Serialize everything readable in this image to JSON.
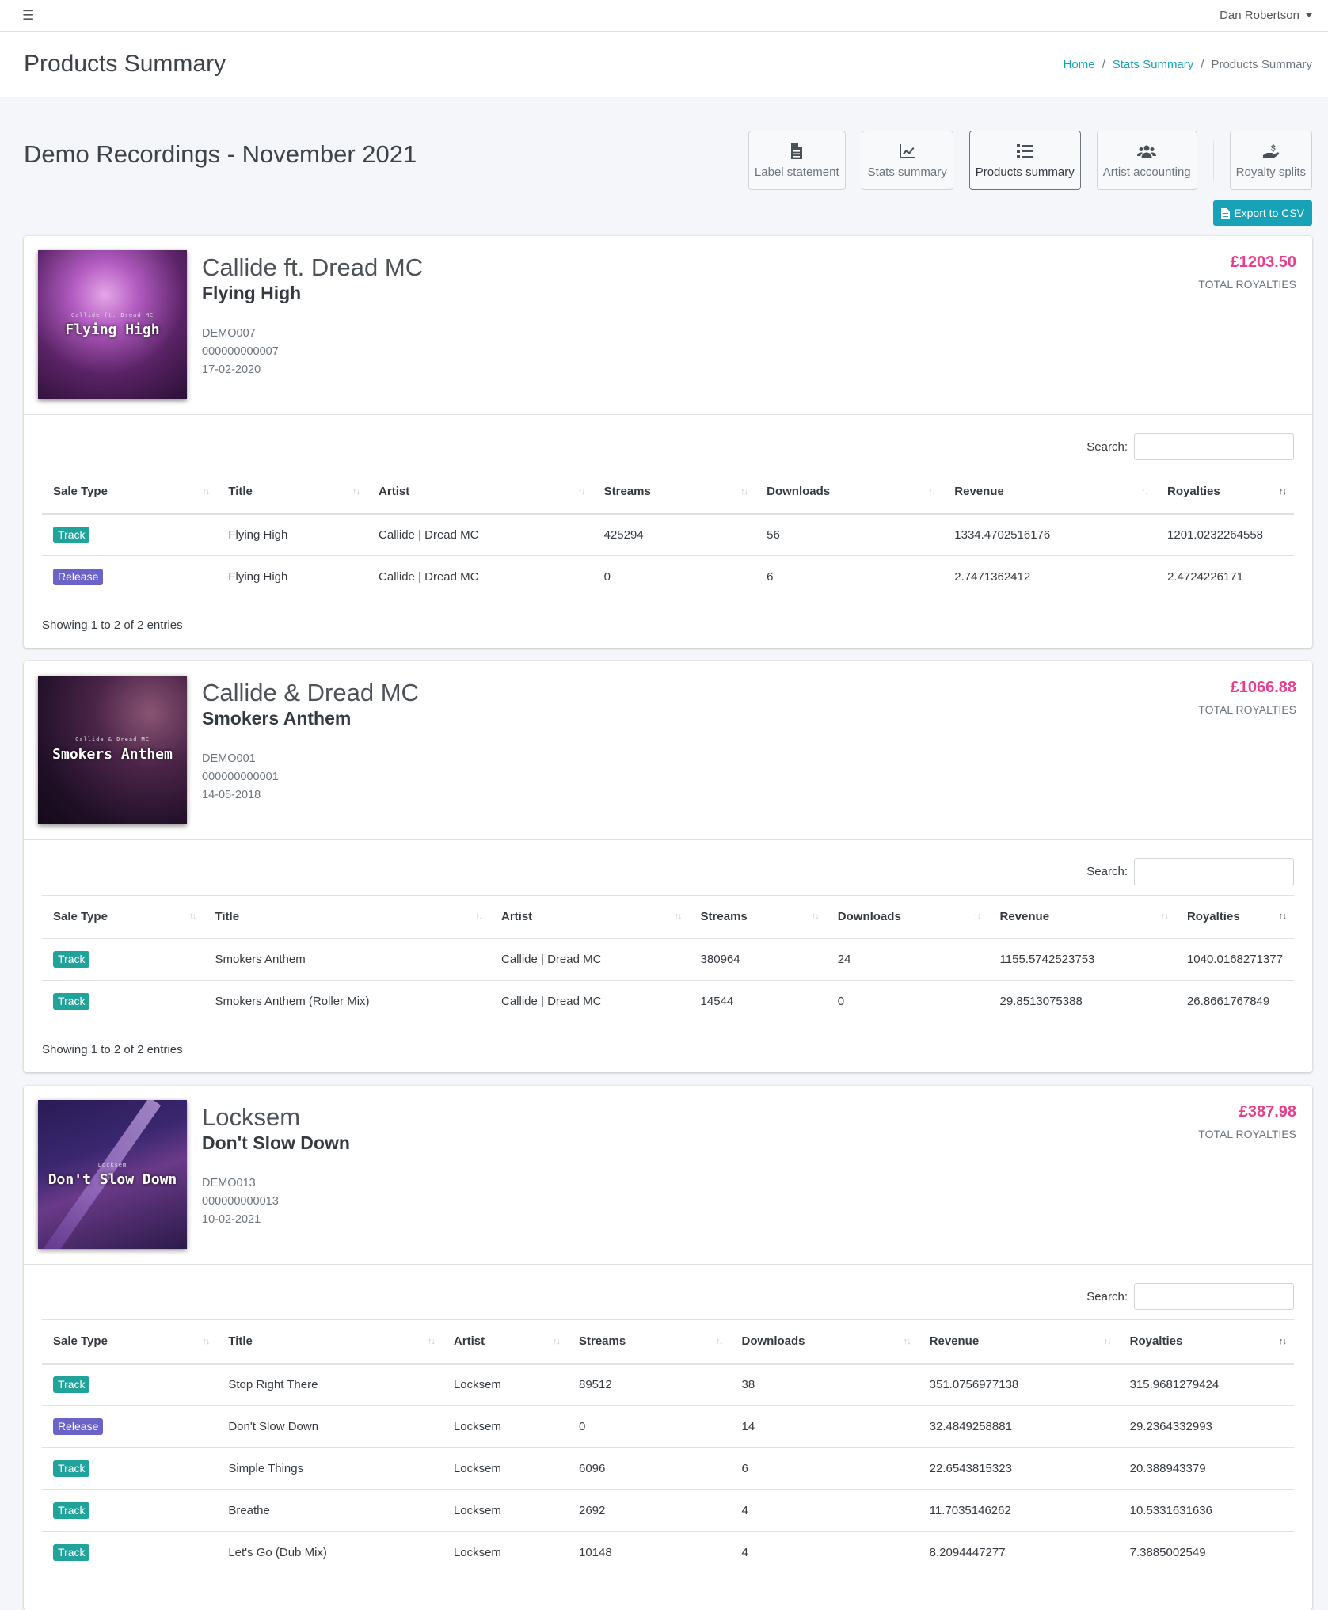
{
  "user": {
    "name": "Dan Robertson"
  },
  "page": {
    "title": "Products Summary"
  },
  "breadcrumb": {
    "home": "Home",
    "stats": "Stats Summary",
    "current": "Products Summary",
    "sep": "/"
  },
  "section": {
    "title": "Demo Recordings - November 2021"
  },
  "nav": {
    "label_statement": "Label statement",
    "stats_summary": "Stats summary",
    "products_summary": "Products summary",
    "artist_accounting": "Artist accounting",
    "royalty_splits": "Royalty splits"
  },
  "export": {
    "label": "Export to CSV"
  },
  "common": {
    "total_royalties": "TOTAL ROYALTIES",
    "search_label": "Search:",
    "columns": [
      "Sale Type",
      "Title",
      "Artist",
      "Streams",
      "Downloads",
      "Revenue",
      "Royalties"
    ]
  },
  "products": [
    {
      "artist": "Callide ft. Dread MC",
      "title": "Flying High",
      "catalog": "DEMO007",
      "upc": "000000000007",
      "date": "17-02-2020",
      "cover_small": "Callide ft. Dread MC",
      "cover_big": "Flying High",
      "royalties": "£1203.50",
      "showing": "Showing 1 to 2 of 2 entries",
      "rows": [
        {
          "type": "Track",
          "title": "Flying High",
          "artist": "Callide | Dread MC",
          "streams": "425294",
          "downloads": "56",
          "revenue": "1334.4702516176",
          "royalties": "1201.0232264558"
        },
        {
          "type": "Release",
          "title": "Flying High",
          "artist": "Callide | Dread MC",
          "streams": "0",
          "downloads": "6",
          "revenue": "2.7471362412",
          "royalties": "2.4724226171"
        }
      ]
    },
    {
      "artist": "Callide & Dread MC",
      "title": "Smokers Anthem",
      "catalog": "DEMO001",
      "upc": "000000000001",
      "date": "14-05-2018",
      "cover_small": "Callide & Dread MC",
      "cover_big": "Smokers Anthem",
      "royalties": "£1066.88",
      "showing": "Showing 1 to 2 of 2 entries",
      "rows": [
        {
          "type": "Track",
          "title": "Smokers Anthem",
          "artist": "Callide | Dread MC",
          "streams": "380964",
          "downloads": "24",
          "revenue": "1155.5742523753",
          "royalties": "1040.0168271377"
        },
        {
          "type": "Track",
          "title": "Smokers Anthem (Roller Mix)",
          "artist": "Callide | Dread MC",
          "streams": "14544",
          "downloads": "0",
          "revenue": "29.8513075388",
          "royalties": "26.8661767849"
        }
      ]
    },
    {
      "artist": "Locksem",
      "title": "Don't Slow Down",
      "catalog": "DEMO013",
      "upc": "000000000013",
      "date": "10-02-2021",
      "cover_small": "Locksem",
      "cover_big": "Don't Slow Down",
      "royalties": "£387.98",
      "showing": "",
      "rows": [
        {
          "type": "Track",
          "title": "Stop Right There",
          "artist": "Locksem",
          "streams": "89512",
          "downloads": "38",
          "revenue": "351.0756977138",
          "royalties": "315.9681279424"
        },
        {
          "type": "Release",
          "title": "Don't Slow Down",
          "artist": "Locksem",
          "streams": "0",
          "downloads": "14",
          "revenue": "32.4849258881",
          "royalties": "29.2364332993"
        },
        {
          "type": "Track",
          "title": "Simple Things",
          "artist": "Locksem",
          "streams": "6096",
          "downloads": "6",
          "revenue": "22.6543815323",
          "royalties": "20.388943379"
        },
        {
          "type": "Track",
          "title": "Breathe",
          "artist": "Locksem",
          "streams": "2692",
          "downloads": "4",
          "revenue": "11.7035146262",
          "royalties": "10.5331631636"
        },
        {
          "type": "Track",
          "title": "Let's Go (Dub Mix)",
          "artist": "Locksem",
          "streams": "10148",
          "downloads": "4",
          "revenue": "8.2094447277",
          "royalties": "7.3885002549"
        }
      ]
    }
  ]
}
